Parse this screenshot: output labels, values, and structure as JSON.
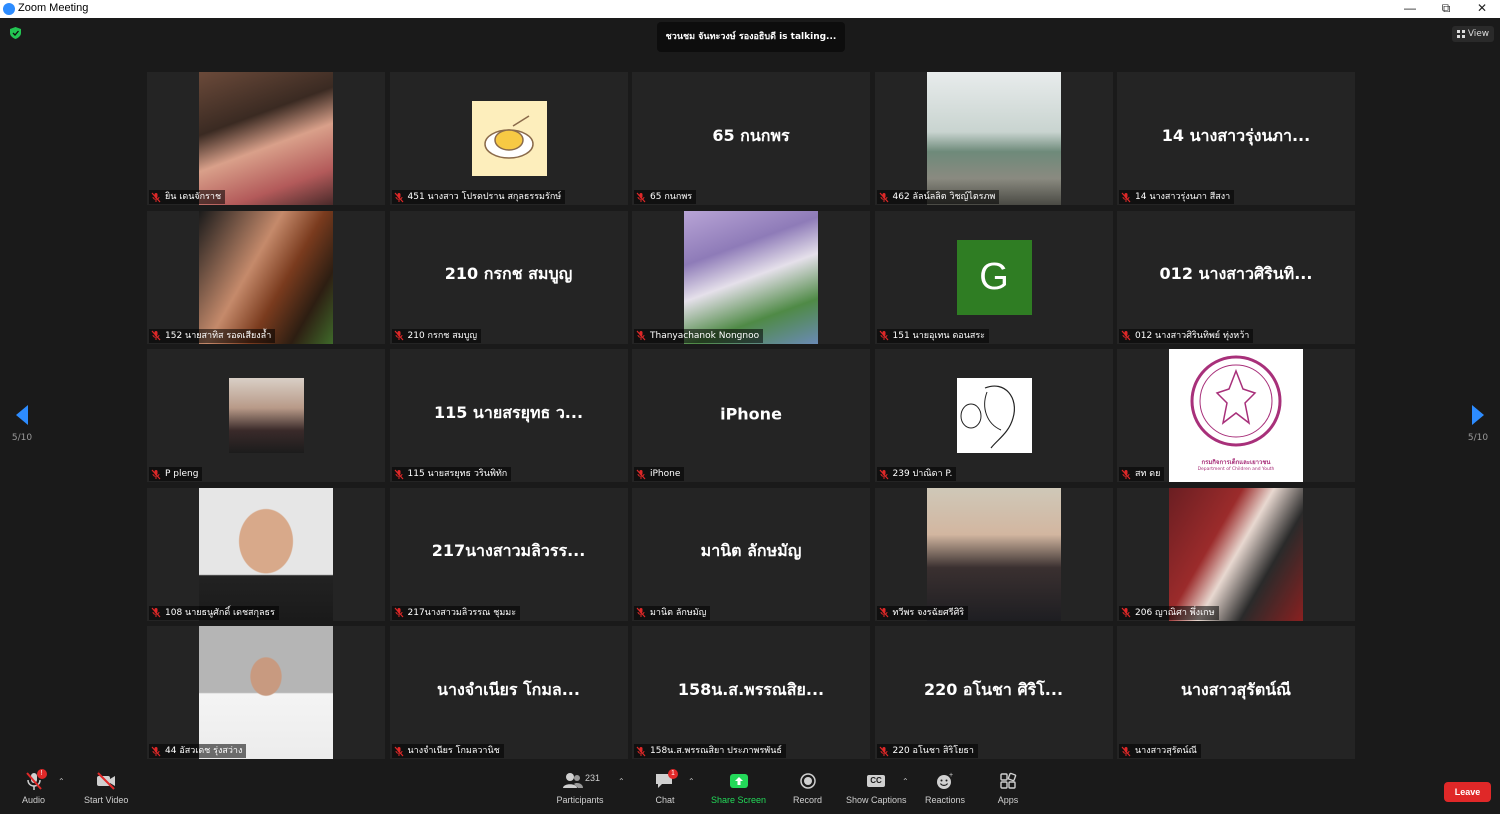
{
  "window": {
    "title": "Zoom Meeting",
    "controls": [
      "minimize",
      "restore",
      "close"
    ]
  },
  "top": {
    "talking_text": "ชวนชม จันทะวงษ์ รองอธิบดี is talking...",
    "view_label": "View"
  },
  "paging": {
    "left": "5/10",
    "right": "5/10"
  },
  "tiles": [
    {
      "label": "ยิน เดนจักราช",
      "display": "photo",
      "photo": "ph-woman1"
    },
    {
      "label": "451 นางสาว โปรดปราน สกุลธรรมรักษ์",
      "display": "thumb",
      "photo": "ph-cake"
    },
    {
      "label": "65 กนกพร",
      "display": "name",
      "big_name": "65 กนกพร"
    },
    {
      "label": "462 ลัลน์ลลิต วิชญ์ไตรภพ",
      "display": "photo",
      "photo": "ph-house"
    },
    {
      "label": "14 นางสาวรุ่งนภา สีสงา",
      "display": "name",
      "big_name": "14 นางสาวรุ่งนภา..."
    },
    {
      "label": "152 นายสาทิส รอดเสียงล้ำ",
      "display": "photo",
      "photo": "ph-man-helmet"
    },
    {
      "label": "210 กรกช สมบูญ",
      "display": "name",
      "big_name": "210 กรกช สมบูญ"
    },
    {
      "label": "Thanyachanok Nongnoo",
      "display": "photo",
      "photo": "ph-girl-purple"
    },
    {
      "label": "151 นายอุเทน ดอนสระ",
      "display": "thumb",
      "photo": "avatar-g",
      "avatar_letter": "G"
    },
    {
      "label": "012 นางสาวศิรินทิพย์ ทุ่งหว้า",
      "display": "name",
      "big_name": "012 นางสาวศิรินทิ..."
    },
    {
      "label": "P pleng",
      "display": "thumb",
      "photo": "ph-girl-small"
    },
    {
      "label": "115 นายสรยุทธ วรินพิทัก",
      "display": "name",
      "big_name": "115 นายสรยุทธ ว..."
    },
    {
      "label": "iPhone",
      "display": "name",
      "big_name": "iPhone"
    },
    {
      "label": "239 ปาณิดา P.",
      "display": "thumb",
      "photo": "ph-sketch"
    },
    {
      "label": "สท ดย",
      "display": "photo",
      "photo": "ph-seal",
      "seal_text": "กรมกิจการเด็กและเยาวชน",
      "seal_subtext": "Department of Children and Youth"
    },
    {
      "label": "108 นายธนูศักดิ์ เดชสกุลธร",
      "display": "photo",
      "photo": "ph-man-suit"
    },
    {
      "label": "217นางสาวมลิวรรณ ชุมมะ",
      "display": "name",
      "big_name": "217นางสาวมลิวรร..."
    },
    {
      "label": "มานิต ลักษมัญ",
      "display": "name",
      "big_name": "มานิต ลักษมัญ"
    },
    {
      "label": "ทวีพร จงรฉัยศรีศิริ",
      "display": "photo",
      "photo": "ph-woman-black"
    },
    {
      "label": "206 ญาณิศา พึ่งเกษ",
      "display": "photo",
      "photo": "ph-woman-mic"
    },
    {
      "label": "44 อัสวเดช รุ่งสว่าง",
      "display": "photo",
      "photo": "ph-man-tie"
    },
    {
      "label": "นางจำเนียร โกมลวานิช",
      "display": "name",
      "big_name": "นางจำเนียร โกมล..."
    },
    {
      "label": "158น.ส.พรรณสิยา ประภาพรพันธ์",
      "display": "name",
      "big_name": "158น.ส.พรรณสิย..."
    },
    {
      "label": "220 อโนชา   สิริโยธา",
      "display": "name",
      "big_name": "220 อโนชา   ศิริโ..."
    },
    {
      "label": "นางสาวสุรัตน์ณี",
      "display": "name",
      "big_name": "นางสาวสุรัตน์ณี"
    }
  ],
  "toolbar": {
    "audio": "Audio",
    "start_video": "Start Video",
    "participants": "Participants",
    "participants_count": "231",
    "chat": "Chat",
    "chat_badge": "1",
    "audio_badge": "!",
    "share_screen": "Share Screen",
    "record": "Record",
    "show_captions": "Show Captions",
    "captions_icon_text": "CC",
    "reactions": "Reactions",
    "apps": "Apps",
    "leave": "Leave"
  },
  "colors": {
    "accent": "#2d8cff",
    "share_green": "#23d959",
    "leave_red": "#e02828",
    "muted_red": "#e02828"
  }
}
